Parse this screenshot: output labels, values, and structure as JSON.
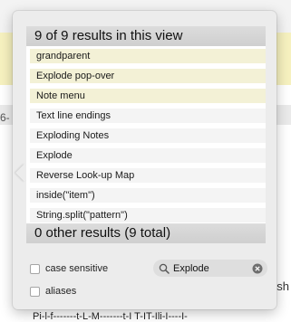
{
  "background": {
    "left_edge_text": "6-",
    "right_edge_text": "sh",
    "bottom_text": "Pi-l-f-------t-L-M-------t-I    T-IT-Ili-I----I-"
  },
  "popover": {
    "results_header": "9 of 9 results in this view",
    "results_footer": "0 other results (9 total)",
    "results": [
      {
        "label": "grandparent",
        "highlighted": true
      },
      {
        "label": "Explode pop-over",
        "highlighted": true
      },
      {
        "label": "Note menu",
        "highlighted": true
      },
      {
        "label": "Text line endings",
        "highlighted": false
      },
      {
        "label": "Exploding Notes",
        "highlighted": false
      },
      {
        "label": "Explode",
        "highlighted": false
      },
      {
        "label": "Reverse Look-up Map",
        "highlighted": false
      },
      {
        "label": "inside(\"item\")",
        "highlighted": false
      },
      {
        "label": "String.split(\"pattern\")",
        "highlighted": false
      }
    ],
    "case_sensitive": {
      "label": "case sensitive",
      "checked": false
    },
    "aliases": {
      "label": "aliases",
      "checked": false
    },
    "search": {
      "value": "Explode",
      "icon": "search-icon",
      "clear_icon": "clear-icon"
    }
  },
  "colors": {
    "highlight": "#f3f1d6",
    "popover_bg": "#ececec",
    "yellow_band": "#f6f1bf"
  }
}
